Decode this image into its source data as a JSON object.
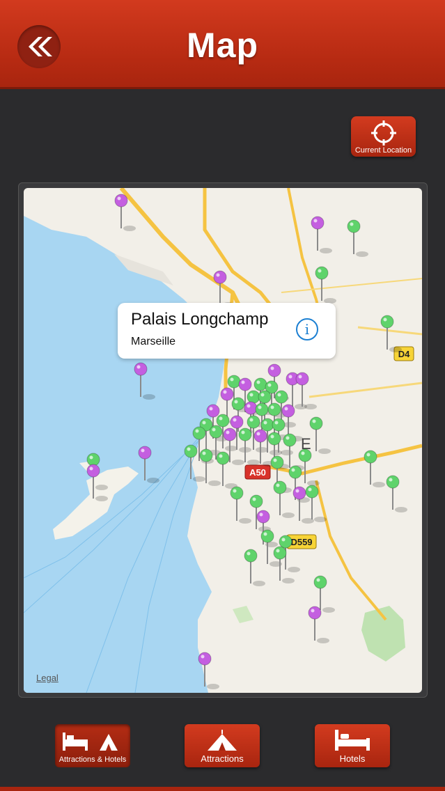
{
  "header": {
    "title": "Map"
  },
  "current_location": {
    "label": "Current Location"
  },
  "map": {
    "callout": {
      "title": "Palais Longchamp",
      "subtitle": "Marseille",
      "info_icon": "i"
    },
    "legal": "Legal",
    "road_labels": [
      "D4",
      "A50",
      "D559"
    ],
    "city_label": "E",
    "pin_colors": {
      "attraction": "#5fd36b",
      "hotel": "#c45fe0"
    }
  },
  "bottom_nav": {
    "attractions_hotels": "Attractions & Hotels",
    "attractions": "Attractions",
    "hotels": "Hotels"
  },
  "colors": {
    "accent": "#c2301a",
    "background": "#2b2b2d",
    "water": "#a8d6f2"
  }
}
